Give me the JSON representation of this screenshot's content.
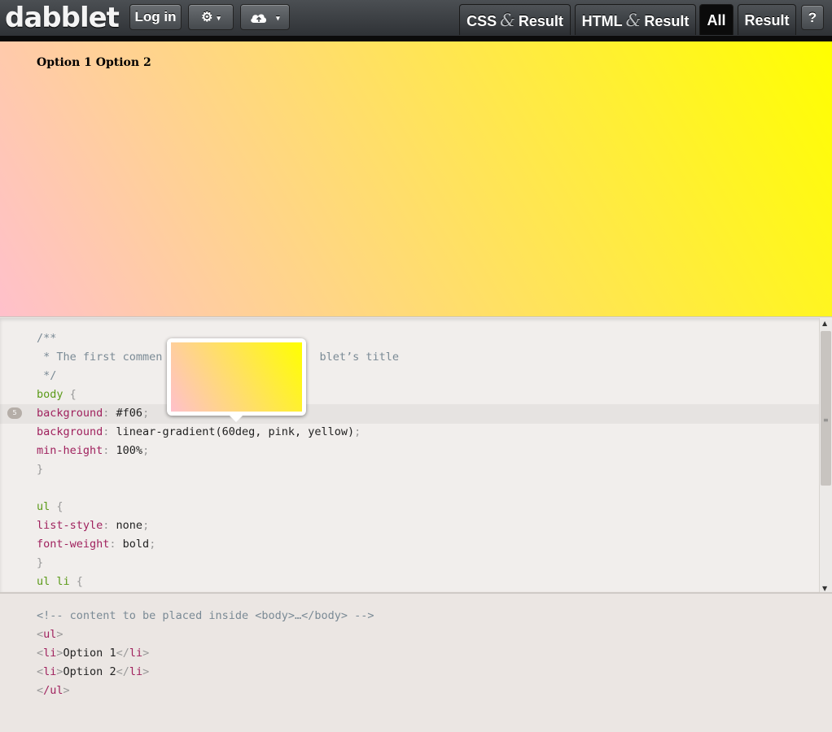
{
  "toolbar": {
    "logo": "dabblet",
    "login_label": "Log in",
    "settings_icon": "gear-icon",
    "cloud_icon": "cloud-upload-icon",
    "caret": "▾",
    "tabs": [
      {
        "left": "CSS",
        "amp": "&",
        "right": "Result"
      },
      {
        "left": "HTML",
        "amp": "&",
        "right": "Result"
      },
      {
        "label": "All",
        "active": true
      },
      {
        "label": "Result"
      }
    ],
    "help_label": "?"
  },
  "result": {
    "items": [
      "Option 1",
      "Option 2"
    ],
    "gradient": "linear-gradient(60deg, pink, yellow)"
  },
  "css_editor": {
    "active_line_number": "5",
    "lines": {
      "l1": "/**",
      "l2a": " * The first commen",
      "l2b": "blet’s title",
      "l3": " */",
      "l4_sel": "body",
      "l4_brace": " {",
      "l5_prop": "background",
      "l5_val": "#f06",
      "l6_prop": "background",
      "l6_val": "linear-gradient(60deg, pink, yellow)",
      "l7_prop": "min-height",
      "l7_val": "100%",
      "l8": "}",
      "l10_sel": "ul",
      "l11_prop": "list-style",
      "l11_val": "none",
      "l12_prop": "font-weight",
      "l12_val": "bold",
      "l13": "}",
      "l14_sel": "ul li"
    },
    "colon": ": ",
    "semicolon": ";",
    "open_brace": " {",
    "close_brace": "}"
  },
  "html_editor": {
    "comment": "<!-- content to be placed inside <body>…</body> -->",
    "ul_open": "ul",
    "li": "li",
    "items": [
      "Option 1",
      "Option 2"
    ],
    "ul_close": "/ul"
  },
  "colors": {
    "selector": "#5b9a18",
    "property": "#a0225e",
    "comment": "#7a8a95"
  }
}
